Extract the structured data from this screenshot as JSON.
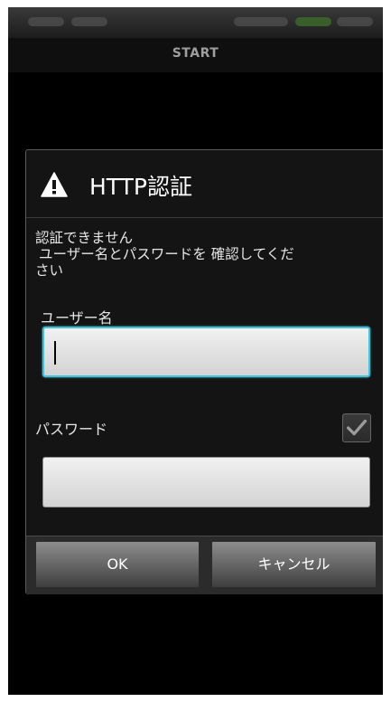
{
  "app_bar": {
    "title": "START"
  },
  "dialog": {
    "icon": "warning-triangle-icon",
    "title": "HTTP認証",
    "message_line1": "認証できません",
    "message_line2": "ユーザー名とパスワードを 確認してくだ",
    "message_line3": "さい",
    "username_label": "ユーザー名",
    "username_value": "",
    "password_label": "パスワード",
    "password_value": "",
    "show_password_checked": true,
    "ok_label": "OK",
    "cancel_label": "キャンセル"
  },
  "colors": {
    "focus_border": "#41c2d9",
    "background": "#000000",
    "dialog_background": "#141414"
  }
}
